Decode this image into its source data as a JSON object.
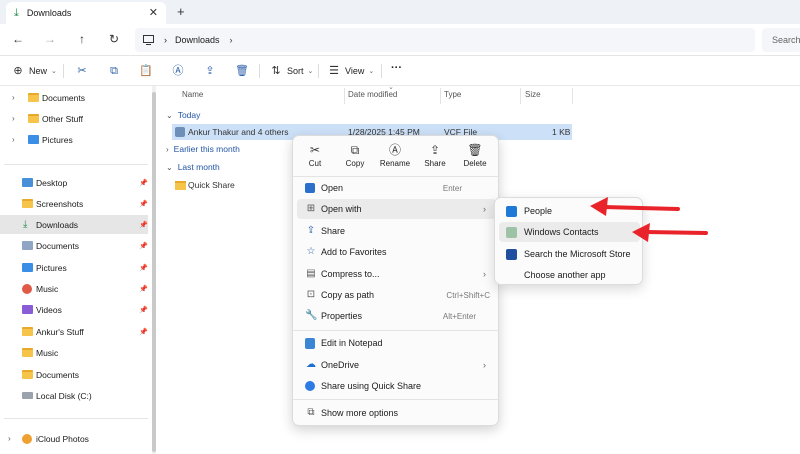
{
  "window": {
    "tab_title": "Downloads",
    "close_glyph": "✕",
    "new_tab_glyph": "+"
  },
  "nav": {
    "back": "←",
    "forward": "→",
    "up": "↑",
    "refresh": "↻",
    "address_segment": "Downloads",
    "address_chevron_1": "›",
    "address_chevron_2": "›",
    "search_placeholder": "Search"
  },
  "toolbar": {
    "new_label": "New",
    "sort_label": "Sort",
    "view_label": "View",
    "more_label": "···"
  },
  "sidebar": {
    "top_items": [
      {
        "label": "Documents"
      },
      {
        "label": "Other Stuff"
      },
      {
        "label": "Pictures"
      }
    ],
    "quick_items": [
      {
        "label": "Desktop"
      },
      {
        "label": "Screenshots"
      },
      {
        "label": "Downloads"
      },
      {
        "label": "Documents"
      },
      {
        "label": "Pictures"
      },
      {
        "label": "Music"
      },
      {
        "label": "Videos"
      },
      {
        "label": "Ankur's Stuff"
      },
      {
        "label": "Music"
      },
      {
        "label": "Documents"
      },
      {
        "label": "Local Disk (C:)"
      }
    ],
    "bottom_item": "iCloud Photos"
  },
  "filelist": {
    "columns": [
      "Name",
      "Date modified",
      "Type",
      "Size"
    ],
    "groups": [
      "Today",
      "Earlier this month",
      "Last month"
    ],
    "rows": [
      {
        "name": "Ankur Thakur and 4 others",
        "date": "1/28/2025 1:45 PM",
        "type": "VCF File",
        "size": "1 KB"
      },
      {
        "name": "Quick Share",
        "date": "",
        "type": "",
        "size": ""
      }
    ]
  },
  "context_menu": {
    "quick_actions": [
      "Cut",
      "Copy",
      "Rename",
      "Share",
      "Delete"
    ],
    "items": [
      {
        "label": "Open",
        "shortcut": "Enter",
        "icon": "app-icon"
      },
      {
        "label": "Open with",
        "shortcut": "",
        "icon": "open-with-icon"
      },
      {
        "label": "Share",
        "shortcut": "",
        "icon": "share-icon"
      },
      {
        "label": "Add to Favorites",
        "shortcut": "",
        "icon": "star-icon"
      },
      {
        "label": "Compress to...",
        "shortcut": "",
        "icon": "zip-icon"
      },
      {
        "label": "Copy as path",
        "shortcut": "Ctrl+Shift+C",
        "icon": "copy-path-icon"
      },
      {
        "label": "Properties",
        "shortcut": "Alt+Enter",
        "icon": "wrench-icon"
      },
      {
        "label": "Edit in Notepad",
        "shortcut": "",
        "icon": "notepad-icon"
      },
      {
        "label": "OneDrive",
        "shortcut": "",
        "icon": "cloud-icon"
      },
      {
        "label": "Share using Quick Share",
        "shortcut": "",
        "icon": "quick-share-icon"
      },
      {
        "label": "Show more options",
        "shortcut": "",
        "icon": "more-options-icon"
      }
    ]
  },
  "submenu": {
    "items": [
      "People",
      "Windows Contacts",
      "Search the Microsoft Store",
      "Choose another app"
    ]
  },
  "colors": {
    "accent": "#2a5ea8",
    "folder": "#f6c44b",
    "selection": "#cce0f7",
    "annotation_arrow": "#e8242a"
  }
}
